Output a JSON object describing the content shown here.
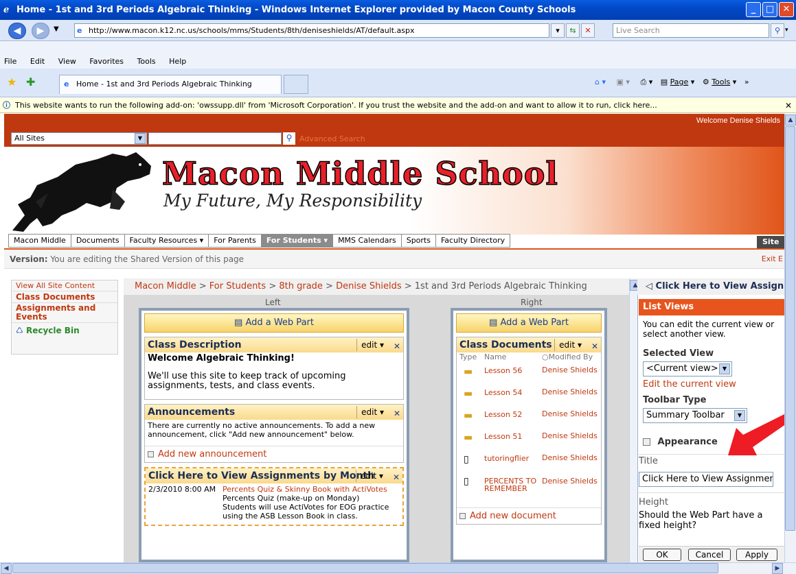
{
  "window": {
    "title": "Home - 1st and 3rd Periods Algebraic Thinking - Windows Internet Explorer provided by Macon County Schools"
  },
  "browser": {
    "url": "http://www.macon.k12.nc.us/schools/mms/Students/8th/deniseshields/AT/default.aspx",
    "search_placeholder": "Live Search",
    "menu": [
      "File",
      "Edit",
      "View",
      "Favorites",
      "Tools",
      "Help"
    ],
    "tab_title": "Home - 1st and 3rd Periods Algebraic Thinking",
    "commands": {
      "page": "Page",
      "tools": "Tools"
    },
    "infobar": "This website wants to run the following add-on: 'owssupp.dll' from 'Microsoft Corporation'. If you trust the website and the add-on and want to allow it to run, click here..."
  },
  "site": {
    "welcome": "Welcome Denise Shields",
    "scope": "All Sites",
    "advanced_search": "Advanced Search",
    "school_name": "Macon Middle School",
    "motto": "My Future, My Responsibility",
    "nav": [
      "Macon Middle",
      "Documents",
      "Faculty Resources ▾",
      "For Parents",
      "For Students ▾",
      "MMS Calendars",
      "Sports",
      "Faculty Directory"
    ],
    "site_actions": "Site A",
    "version_label": "Version:",
    "version_text": "You are editing the Shared Version of this page",
    "exit_edit": "Exit E"
  },
  "quicklaunch": {
    "view_all": "View All Site Content",
    "class_documents": "Class Documents",
    "assignments": "Assignments and Events",
    "recycle": "Recycle Bin"
  },
  "breadcrumb": {
    "items": [
      "Macon Middle",
      "For Students",
      "8th grade",
      "Denise Shields"
    ],
    "separator": " > ",
    "current": "1st and 3rd Periods Algebraic Thinking"
  },
  "zones": {
    "left": "Left",
    "right": "Right",
    "add_web_part": "Add a Web Part"
  },
  "webparts": {
    "edit": "edit ▾",
    "class_description": {
      "title": "Class Description",
      "heading": "Welcome Algebraic Thinking!",
      "body": "We'll use this site to keep track of upcoming assignments, tests, and class events."
    },
    "announcements": {
      "title": "Announcements",
      "body": "There are currently no active announcements. To add a new announcement, click \"Add new announcement\" below.",
      "add": "Add new announcement"
    },
    "calendar": {
      "title": "Click Here to View Assignments by Month",
      "date": "2/3/2010 8:00 AM",
      "event": "Percents Quiz & Skinny Book with ActiVotes",
      "line1": "Percents Quiz (make-up on Monday)",
      "line2": "Students will use ActiVotes for EOG practice using the ASB Lesson Book in class."
    },
    "class_documents": {
      "title": "Class Documents",
      "columns": [
        "Type",
        "Name",
        "Modified By"
      ],
      "rows": [
        {
          "name": "Lesson 56",
          "by": "Denise Shields",
          "type": "folder"
        },
        {
          "name": "Lesson 54",
          "by": "Denise Shields",
          "type": "folder"
        },
        {
          "name": "Lesson 52",
          "by": "Denise Shields",
          "type": "folder"
        },
        {
          "name": "Lesson 51",
          "by": "Denise Shields",
          "type": "folder"
        },
        {
          "name": "tutoringflier",
          "by": "Denise Shields",
          "type": "doc"
        },
        {
          "name": "PERCENTS TO REMEMBER",
          "by": "Denise Shields",
          "type": "doc"
        }
      ],
      "add": "Add new document"
    }
  },
  "toolpane": {
    "header": "Click Here to View Assignm",
    "list_views": "List Views",
    "desc": "You can edit the current view or select another view.",
    "selected_view_label": "Selected View",
    "selected_view": "<Current view>",
    "edit_view": "Edit the current view",
    "toolbar_type_label": "Toolbar Type",
    "toolbar_type": "Summary Toolbar",
    "appearance": "Appearance",
    "title_label": "Title",
    "title_value": "Click Here to View Assignmen",
    "height_label": "Height",
    "height_question": "Should the Web Part have a fixed height?",
    "ok": "OK",
    "cancel": "Cancel",
    "apply": "Apply"
  },
  "colors": {
    "brand": "#c0380f",
    "accent": "#e8541d",
    "link": "#c0380f",
    "arrow": "#ee1c24"
  }
}
